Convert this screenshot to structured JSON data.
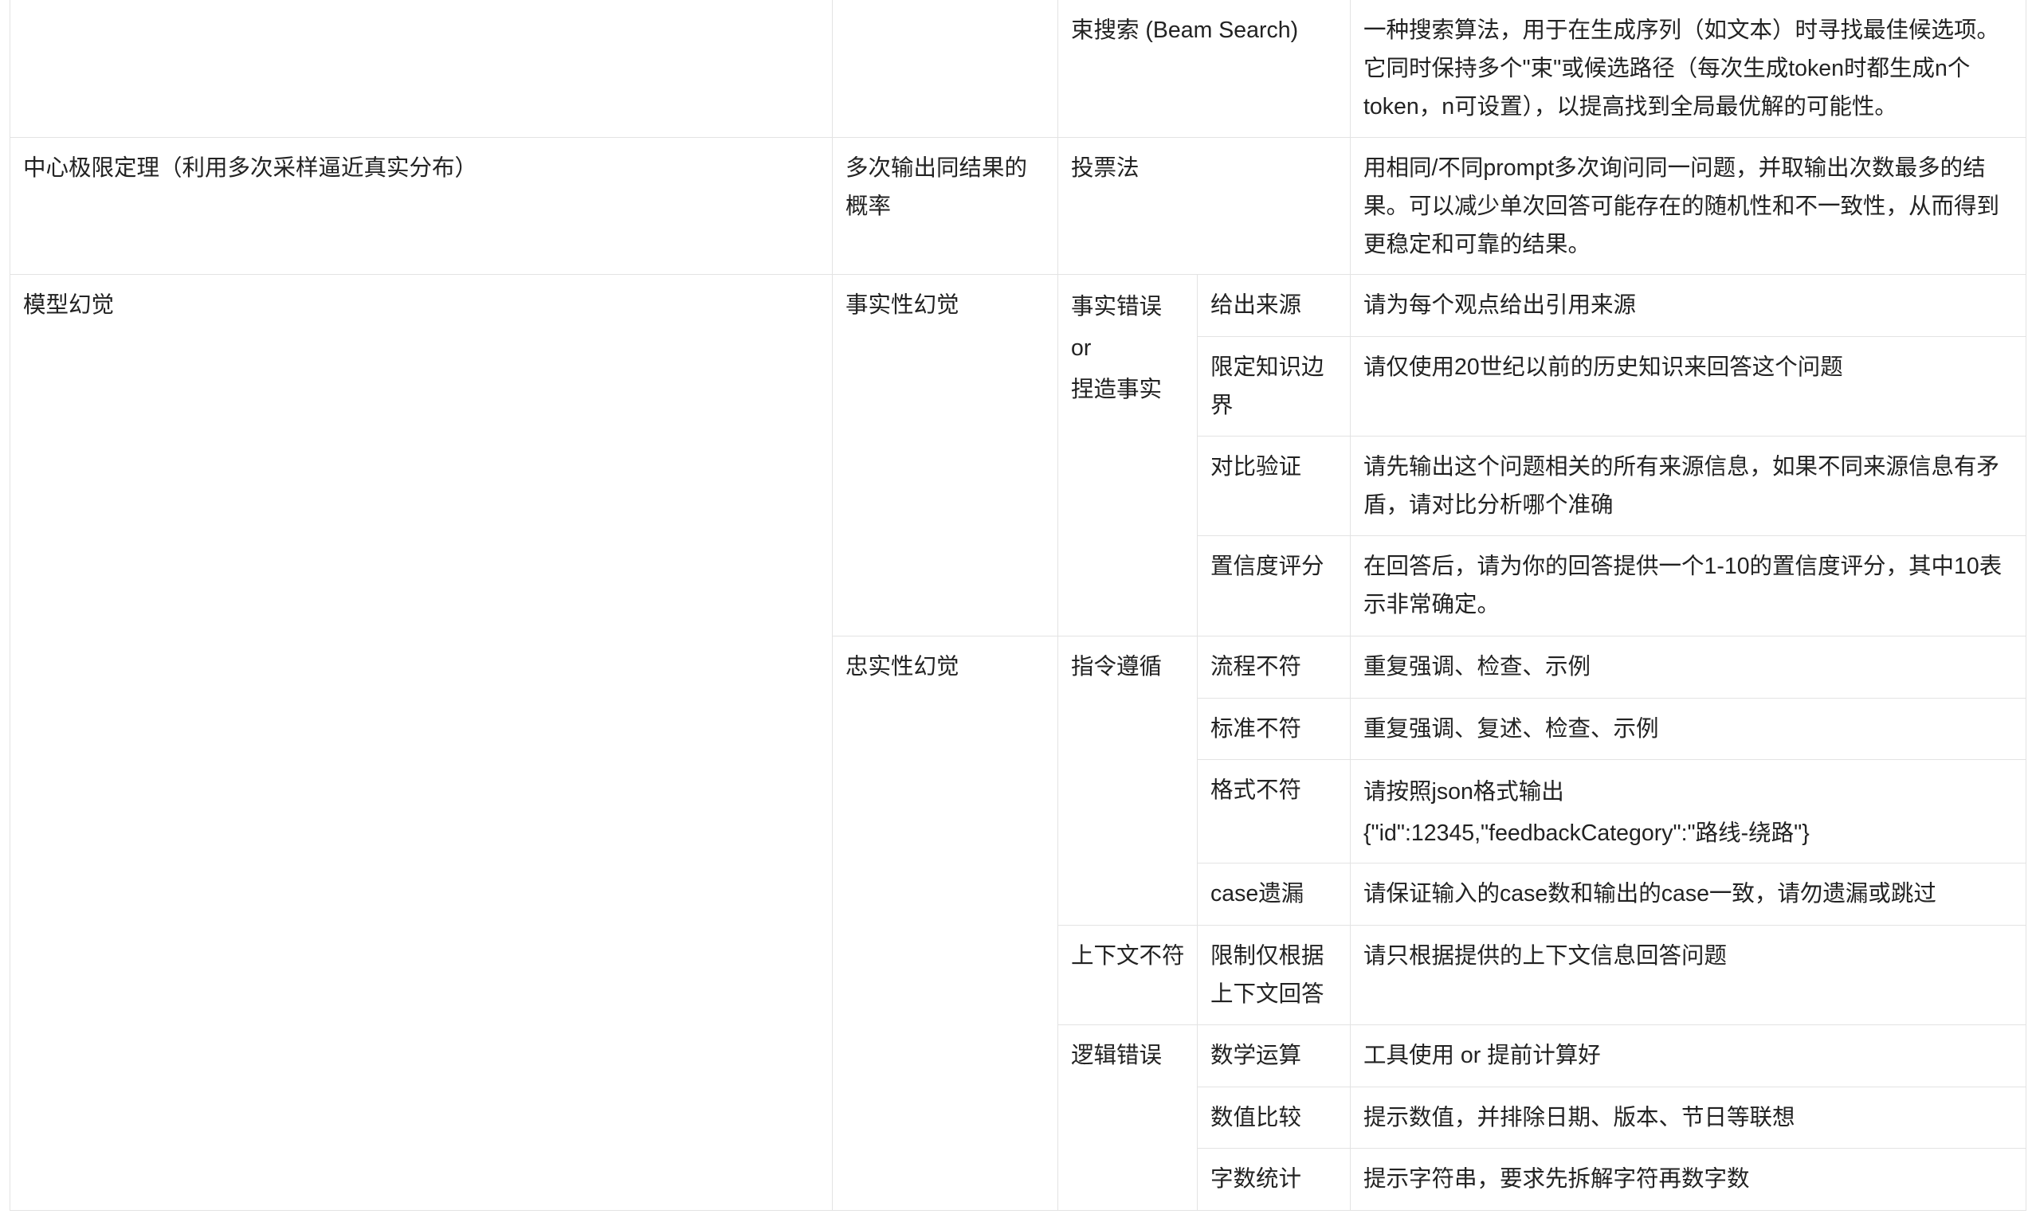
{
  "table": {
    "partial_row": {
      "technique": "束搜索 (Beam Search)",
      "description": "一种搜索算法，用于在生成序列（如文本）时寻找最佳候选项。它同时保持多个\"束\"或候选路径（每次生成token时都生成n个token，n可设置），以提高找到全局最优解的可能性。"
    },
    "clt_row": {
      "theory": "中心极限定理（利用多次采样逼近真实分布）",
      "method": "多次输出同结果的概率",
      "technique": "投票法",
      "description": "用相同/不同prompt多次询问同一问题，并取输出次数最多的结果。可以减少单次回答可能存在的随机性和不一致性，从而得到更稳定和可靠的结果。"
    },
    "hallucination": {
      "title": "模型幻觉",
      "factual": {
        "label": "事实性幻觉",
        "subtype": {
          "line1": "事实错误",
          "line2": "or",
          "line3": "捏造事实"
        },
        "items": [
          {
            "name": "给出来源",
            "prompt": "请为每个观点给出引用来源"
          },
          {
            "name": "限定知识边界",
            "prompt": "请仅使用20世纪以前的历史知识来回答这个问题"
          },
          {
            "name": "对比验证",
            "prompt": "请先输出这个问题相关的所有来源信息，如果不同来源信息有矛盾，请对比分析哪个准确"
          },
          {
            "name": "置信度评分",
            "prompt": "在回答后，请为你的回答提供一个1-10的置信度评分，其中10表示非常确定。"
          }
        ]
      },
      "faithful": {
        "label": "忠实性幻觉",
        "instruction": {
          "label": "指令遵循",
          "items": [
            {
              "name": "流程不符",
              "prompt": "重复强调、检查、示例"
            },
            {
              "name": "标准不符",
              "prompt": "重复强调、复述、检查、示例"
            },
            {
              "name": "格式不符",
              "prompt_line1": "请按照json格式输出",
              "prompt_line2": "{\"id\":12345,\"feedbackCategory\":\"路线-绕路\"}"
            },
            {
              "name": "case遗漏",
              "prompt": "请保证输入的case数和输出的case一致，请勿遗漏或跳过"
            }
          ]
        },
        "context": {
          "label": "上下文不符",
          "name": "限制仅根据上下文回答",
          "prompt": "请只根据提供的上下文信息回答问题"
        },
        "logic": {
          "label": "逻辑错误",
          "items": [
            {
              "name": "数学运算",
              "prompt": "工具使用 or 提前计算好"
            },
            {
              "name": "数值比较",
              "prompt": "提示数值，并排除日期、版本、节日等联想"
            },
            {
              "name": "字数统计",
              "prompt": "提示字符串，要求先拆解字符再数字数"
            }
          ]
        }
      }
    }
  }
}
